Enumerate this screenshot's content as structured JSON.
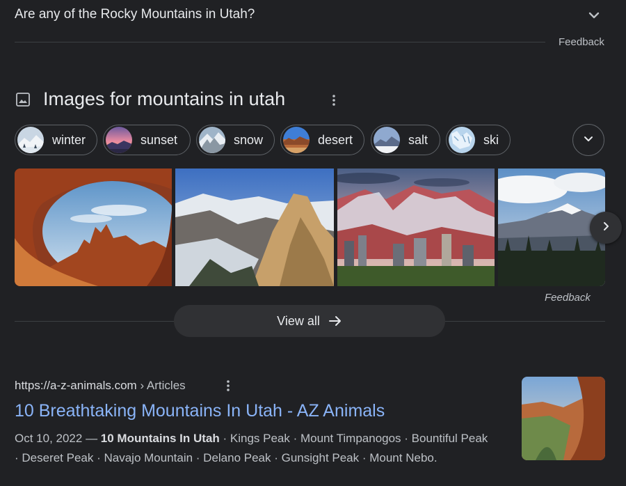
{
  "faq": {
    "question": "Are any of the Rocky Mountains in Utah?",
    "feedback": "Feedback"
  },
  "images_section": {
    "title": "Images for mountains in utah",
    "chips": [
      {
        "label": "winter"
      },
      {
        "label": "sunset"
      },
      {
        "label": "snow"
      },
      {
        "label": "desert"
      },
      {
        "label": "salt"
      },
      {
        "label": "ski"
      }
    ],
    "feedback": "Feedback",
    "view_all": "View all"
  },
  "result": {
    "url": "https://a-z-animals.com",
    "breadcrumb": "› Articles",
    "title": "10 Breathtaking Mountains In Utah - AZ Animals",
    "date": "Oct 10, 2022 — ",
    "snippet_bold": "10 Mountains In Utah",
    "snippet_line1_rest": " · Kings Peak · Mount Timpanogos · Bountiful Peak",
    "snippet_line2": "· Deseret Peak · Navajo Mountain · Delano Peak · Gunsight Peak · Mount Nebo."
  },
  "icons": {
    "chevron": "chevron-down-icon",
    "images": "image-icon",
    "more": "more-vert-icon",
    "next": "chevron-right-icon",
    "arrow": "arrow-right-icon"
  },
  "colors": {
    "background": "#202124",
    "link": "#8ab4f8",
    "text": "#e8eaed",
    "muted": "#bdc1c6",
    "border": "#5f6368",
    "button_bg": "#303134"
  }
}
